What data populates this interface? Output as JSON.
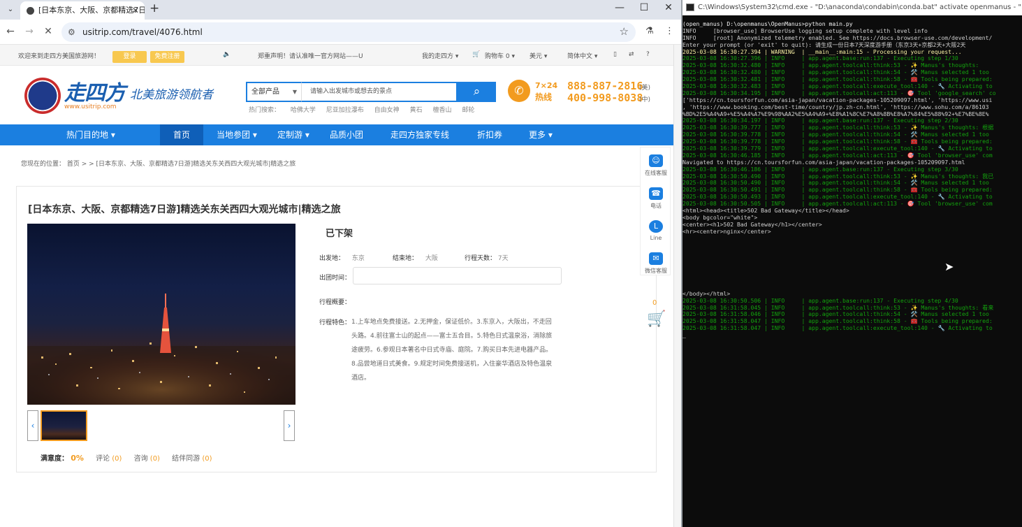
{
  "browser": {
    "tab_title": "[日本东京、大阪、京都精选7日",
    "url": "usitrip.com/travel/4076.html"
  },
  "site": {
    "topbar": {
      "welcome": "欢迎来到走四方美国旅游网！",
      "login": "登录",
      "register": "免费注册",
      "notice": "郑重声明！请认准唯一官方网站——U",
      "my_account": "我的走四方 ▾",
      "cart": "购物车 0 ▾",
      "currency": "美元 ▾",
      "language": "简体中文 ▾"
    },
    "logo_text": "走四方",
    "logo_url": "www.usitrip.com",
    "slogan": "北美旅游领航者",
    "search": {
      "category": "全部产品",
      "placeholder": "请输入出发城市或想去的景点",
      "hot_label": "热门搜索：",
      "hot_items": [
        "哈佛大学",
        "尼亚加拉瀑布",
        "自由女神",
        "黄石",
        "檀香山",
        "邮轮"
      ]
    },
    "hotline": {
      "label_a": "7×24",
      "label_b": "热线",
      "phone_us": "888-887-2816",
      "tag_us": "(美)",
      "phone_cn": "400-998-8038",
      "tag_cn": "(中)"
    },
    "nav": [
      "热门目的地  ▾",
      "首页",
      "当地参团 ▾",
      "定制游 ▾",
      "品质小团",
      "走四方独家专线",
      "折扣券",
      "更多 ▾"
    ],
    "breadcrumb": "您现在的位置：     首页 > > [日本东京、大阪、京都精选7日游]精选关东关西四大观光城市|精选之旅",
    "product": {
      "title": "[日本东京、大阪、京都精选7日游]精选关东关西四大观光城市|精选之旅",
      "status": "已下架",
      "depart_label": "出发地：",
      "depart": "东京",
      "end_label": "结束地：",
      "end": "大阪",
      "days_label": "行程天数：",
      "days": "7天",
      "date_label": "出团时间：",
      "summary_label": "行程概要：",
      "features_label": "行程特色：",
      "features": "1.上车地点免费接送。2.无押金，保证低价。3.东京入，大阪出，不走回头路。4.前往富士山的起点——富士五合目。5.特色日式温泉浴，消除旅途疲劳。6.参观日本著名中日式寺庙、庭院。7.购买日本先进电器产品。8.品尝地道日式美食。9.规定时间免费接送机，入住豪华酒店及特色温泉酒店。",
      "satisfaction_label": "满意度：",
      "satisfaction": "0%",
      "reviews": "评论",
      "reviews_count": "(0)",
      "consult": "咨询",
      "consult_count": "(0)",
      "companion": "结伴同游",
      "companion_count": "(0)"
    },
    "sidebar": [
      "在线客服",
      "电话",
      "Line",
      "微信客服"
    ],
    "float_cart_count": "0"
  },
  "cmd": {
    "title": "C:\\Windows\\System32\\cmd.exe - \"D:\\anaconda\\condabin\\conda.bat\"  activate openmanus - \"D:\\anaconda",
    "lines": [
      {
        "t": "(open_manus) D:\\openmanus\\OpenManus>python main.py",
        "c": "w"
      },
      {
        "t": "INFO     [browser_use] BrowserUse logging setup complete with level info",
        "c": ""
      },
      {
        "t": "INFO     [root] Anonymized telemetry enabled. See https://docs.browser-use.com/development/",
        "c": ""
      },
      {
        "t": "Enter your prompt (or 'exit' to quit): 请生成一份日本7天深度游手册（东京3天+京都2天+大阪2天",
        "c": ""
      },
      {
        "t": "2025-03-08 16:30:27.394 | WARNING  | __main__:main:15 - Processing your request...",
        "c": "y"
      },
      {
        "t": "2025-03-08 16:30:27.396 | INFO     | app.agent.base:run:137 - Executing step 1/30",
        "c": "g"
      },
      {
        "t": "2025-03-08 16:30:32.480 | INFO     | app.agent.toolcall:think:53 - ✨ Manus's thoughts:",
        "c": "g"
      },
      {
        "t": "2025-03-08 16:30:32.480 | INFO     | app.agent.toolcall:think:54 - 🛠️ Manus selected 1 too",
        "c": "g"
      },
      {
        "t": "2025-03-08 16:30:32.481 | INFO     | app.agent.toolcall:think:58 - 🧰 Tools being prepared:",
        "c": "g"
      },
      {
        "t": "2025-03-08 16:30:32.483 | INFO     | app.agent.toolcall:execute_tool:140 - 🔧 Activating to",
        "c": "g"
      },
      {
        "t": "2025-03-08 16:30:34.195 | INFO     | app.agent.toolcall:act:113 - 🎯 Tool 'google_search' co",
        "c": "g"
      },
      {
        "t": "['https://cn.toursforfun.com/asia-japan/vacation-packages-105209097.html', 'https://www.usi",
        "c": ""
      },
      {
        "t": ", 'https://www.booking.com/best-time/country/jp.zh-cn.html', 'https://www.sohu.com/a/86103",
        "c": ""
      },
      {
        "t": "%BD%2E5%A4%A9+%E5%A4%A7%E9%98%AA2%E5%A4%A9+%E8%A1%8C%E7%A8%8B%E8%A7%84%E5%88%92+%E7%BE%8E%",
        "c": ""
      },
      {
        "t": "2025-03-08 16:30:34.197 | INFO     | app.agent.base:run:137 - Executing step 2/30",
        "c": "g"
      },
      {
        "t": "2025-03-08 16:30:39.777 | INFO     | app.agent.toolcall:think:53 - ✨ Manus's thoughts: 根据",
        "c": "g"
      },
      {
        "t": "2025-03-08 16:30:39.778 | INFO     | app.agent.toolcall:think:54 - 🛠️ Manus selected 1 too",
        "c": "g"
      },
      {
        "t": "2025-03-08 16:30:39.778 | INFO     | app.agent.toolcall:think:58 - 🧰 Tools being prepared:",
        "c": "g"
      },
      {
        "t": "2025-03-08 16:30:39.779 | INFO     | app.agent.toolcall:execute_tool:140 - 🔧 Activating to",
        "c": "g"
      },
      {
        "t": "2025-03-08 16:30:46.185 | INFO     | app.agent.toolcall:act:113 - 🎯 Tool 'browser_use' com",
        "c": "g"
      },
      {
        "t": "Navigated to https://cn.toursforfun.com/asia-japan/vacation-packages-105209097.html",
        "c": ""
      },
      {
        "t": "2025-03-08 16:30:46.186 | INFO     | app.agent.base:run:137 - Executing step 3/30",
        "c": "g"
      },
      {
        "t": "2025-03-08 16:30:50.490 | INFO     | app.agent.toolcall:think:53 - ✨ Manus's thoughts: 我已",
        "c": "g"
      },
      {
        "t": "2025-03-08 16:30:50.490 | INFO     | app.agent.toolcall:think:54 - 🛠️ Manus selected 1 too",
        "c": "g"
      },
      {
        "t": "2025-03-08 16:30:50.491 | INFO     | app.agent.toolcall:think:58 - 🧰 Tools being prepared:",
        "c": "g"
      },
      {
        "t": "2025-03-08 16:30:50.493 | INFO     | app.agent.toolcall:execute_tool:140 - 🔧 Activating to",
        "c": "g"
      },
      {
        "t": "2025-03-08 16:30:50.505 | INFO     | app.agent.toolcall:act:113 - 🎯 Tool 'browser_use' com",
        "c": "g"
      },
      {
        "t": "<html><head><title>502 Bad Gateway</title></head>",
        "c": ""
      },
      {
        "t": "<body bgcolor=\"white\">",
        "c": ""
      },
      {
        "t": "<center><h1>502 Bad Gateway</h1></center>",
        "c": ""
      },
      {
        "t": "<hr><center>nginx</center>",
        "c": ""
      },
      {
        "t": "",
        "c": ""
      },
      {
        "t": "",
        "c": ""
      },
      {
        "t": "",
        "c": ""
      },
      {
        "t": "",
        "c": ""
      },
      {
        "t": "",
        "c": ""
      },
      {
        "t": "",
        "c": ""
      },
      {
        "t": "",
        "c": ""
      },
      {
        "t": "",
        "c": ""
      },
      {
        "t": "</body></html>",
        "c": ""
      },
      {
        "t": "2025-03-08 16:30:50.506 | INFO     | app.agent.base:run:137 - Executing step 4/30",
        "c": "g"
      },
      {
        "t": "2025-03-08 16:31:58.045 | INFO     | app.agent.toolcall:think:53 - ✨ Manus's thoughts: 看来",
        "c": "g"
      },
      {
        "t": "2025-03-08 16:31:58.046 | INFO     | app.agent.toolcall:think:54 - 🛠️ Manus selected 1 too",
        "c": "g"
      },
      {
        "t": "2025-03-08 16:31:58.047 | INFO     | app.agent.toolcall:think:58 - 🧰 Tools being prepared:",
        "c": "g"
      },
      {
        "t": "2025-03-08 16:31:58.047 | INFO     | app.agent.toolcall:execute_tool:140 - 🔧 Activating to",
        "c": "g"
      },
      {
        "t": "_",
        "c": "w"
      }
    ]
  }
}
